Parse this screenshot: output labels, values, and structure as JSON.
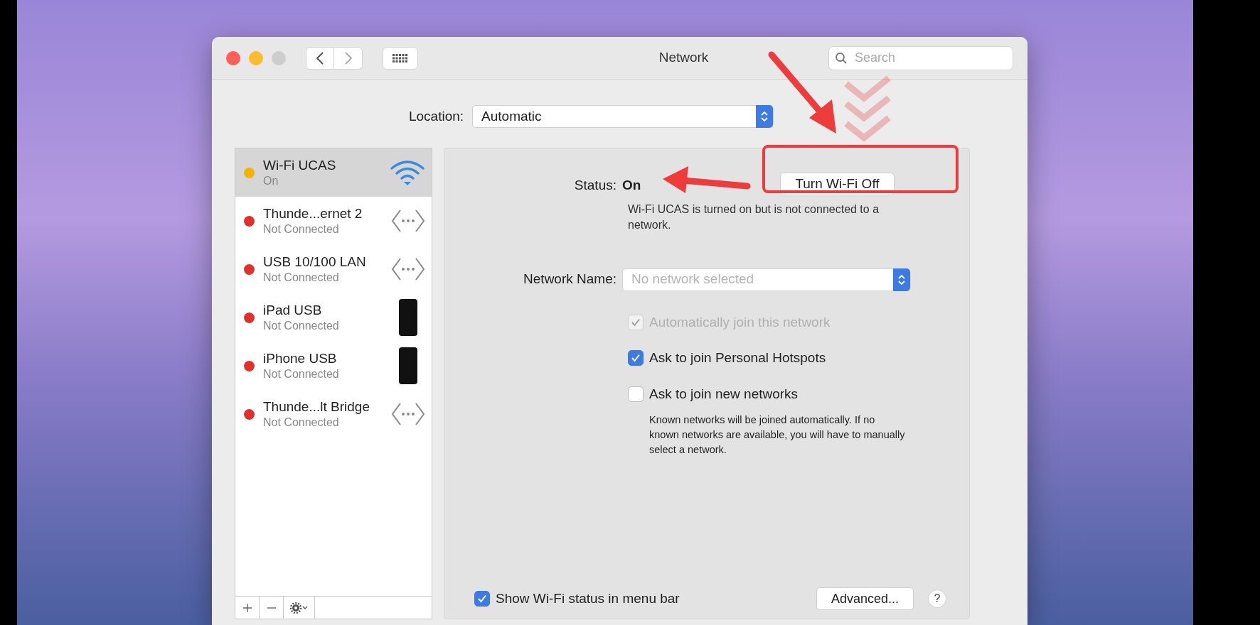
{
  "window": {
    "title": "Network"
  },
  "search": {
    "placeholder": "Search"
  },
  "location": {
    "label": "Location:",
    "value": "Automatic"
  },
  "services": [
    {
      "name": "Wi-Fi UCAS",
      "status": "On",
      "color": "#f0b400",
      "selected": true,
      "kind": "wifi"
    },
    {
      "name": "Thunde...ernet 2",
      "status": "Not Connected",
      "color": "#e0302c",
      "selected": false,
      "kind": "ethernet"
    },
    {
      "name": "USB 10/100 LAN",
      "status": "Not Connected",
      "color": "#e0302c",
      "selected": false,
      "kind": "ethernet"
    },
    {
      "name": "iPad USB",
      "status": "Not Connected",
      "color": "#e0302c",
      "selected": false,
      "kind": "device"
    },
    {
      "name": "iPhone USB",
      "status": "Not Connected",
      "color": "#e0302c",
      "selected": false,
      "kind": "device"
    },
    {
      "name": "Thunde...lt Bridge",
      "status": "Not Connected",
      "color": "#e0302c",
      "selected": false,
      "kind": "ethernet"
    }
  ],
  "detail": {
    "status_label": "Status:",
    "status_value": "On",
    "toggle_button": "Turn Wi-Fi Off",
    "description": "Wi-Fi UCAS is turned on but is not connected to a network.",
    "network_name_label": "Network Name:",
    "network_name_placeholder": "No network selected",
    "options": [
      {
        "label": "Automatically join this network",
        "checked": true,
        "disabled": true
      },
      {
        "label": "Ask to join Personal Hotspots",
        "checked": true,
        "disabled": false
      },
      {
        "label": "Ask to join new networks",
        "checked": false,
        "disabled": false
      }
    ],
    "note": "Known networks will be joined automatically. If no known networks are available, you will have to manually select a network."
  },
  "footer": {
    "show_status": {
      "label": "Show Wi-Fi status in menu bar",
      "checked": true
    },
    "advanced_button": "Advanced...",
    "help_button": "?"
  }
}
